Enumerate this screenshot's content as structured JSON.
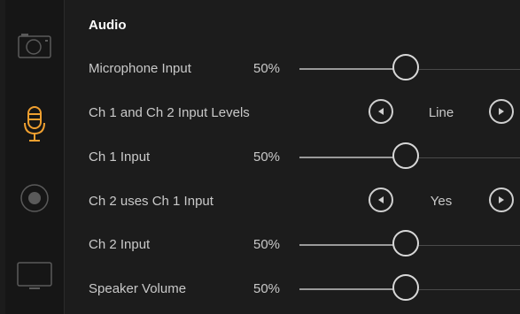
{
  "colors": {
    "accent": "#f0a030",
    "background": "#1c1c1c",
    "sidebar": "#161616",
    "text": "#c9c9c9",
    "title": "#ffffff"
  },
  "sidebar": {
    "items": [
      {
        "icon": "camera-icon",
        "active": false
      },
      {
        "icon": "microphone-icon",
        "active": true
      },
      {
        "icon": "record-icon",
        "active": false
      },
      {
        "icon": "monitor-icon",
        "active": false
      }
    ]
  },
  "audio": {
    "title": "Audio",
    "microphone_input": {
      "label": "Microphone Input",
      "value_text": "50%",
      "level": 0.5
    },
    "ch_input_levels": {
      "label": "Ch 1 and Ch 2 Input Levels",
      "value": "Line"
    },
    "ch1_input": {
      "label": "Ch 1 Input",
      "value_text": "50%",
      "level": 0.5
    },
    "ch2_uses_ch1": {
      "label": "Ch 2 uses Ch 1 Input",
      "value": "Yes"
    },
    "ch2_input": {
      "label": "Ch 2 Input",
      "value_text": "50%",
      "level": 0.5
    },
    "speaker_volume": {
      "label": "Speaker Volume",
      "value_text": "50%",
      "level": 0.5
    }
  }
}
